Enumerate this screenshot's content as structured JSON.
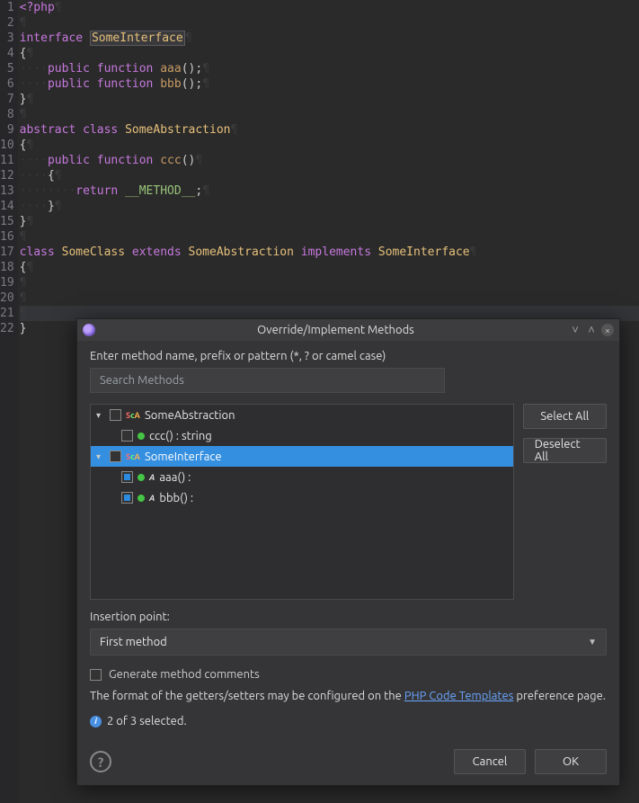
{
  "code": {
    "lines": [
      1,
      2,
      3,
      4,
      5,
      6,
      7,
      8,
      9,
      10,
      11,
      12,
      13,
      14,
      15,
      16,
      17,
      18,
      19,
      20,
      21,
      22
    ],
    "selected_symbol": "SomeInterface",
    "l1": "<?php",
    "l3_kw": "interface",
    "l5_vis": "public",
    "l5_fn": "function",
    "l5_name": "aaa",
    "l6_vis": "public",
    "l6_fn": "function",
    "l6_name": "bbb",
    "l9_kw1": "abstract",
    "l9_kw2": "class",
    "l9_name": "SomeAbstraction",
    "l11_vis": "public",
    "l11_fn": "function",
    "l11_name": "ccc",
    "l13_ret": "return",
    "l13_const": "__METHOD__",
    "l17_kw": "class",
    "l17_c": "SomeClass",
    "l17_ext": "extends",
    "l17_parent": "SomeAbstraction",
    "l17_impl": "implements",
    "l17_iface": "SomeInterface"
  },
  "dialog": {
    "title": "Override/Implement Methods",
    "hint": "Enter method name, prefix or pattern (*, ? or camel case)",
    "search_placeholder": "Search Methods",
    "select_all": "Select All",
    "deselect_all": "Deselect All",
    "tree": [
      {
        "label": "SomeAbstraction",
        "checked": false,
        "selected": false,
        "children": [
          {
            "label": "ccc() : string",
            "checked": false
          }
        ]
      },
      {
        "label": "SomeInterface",
        "checked": false,
        "selected": true,
        "children": [
          {
            "label": "aaa() :",
            "checked": true
          },
          {
            "label": "bbb() :",
            "checked": true
          }
        ]
      }
    ],
    "insertion_label": "Insertion point:",
    "insertion_value": "First method",
    "gen_comments": "Generate method comments",
    "gen_comments_checked": false,
    "format_hint_pre": "The format of the getters/setters may be configured on the ",
    "format_link": "PHP Code Templates",
    "format_hint_post": " preference page.",
    "status": "2 of 3 selected.",
    "cancel": "Cancel",
    "ok": "OK"
  }
}
